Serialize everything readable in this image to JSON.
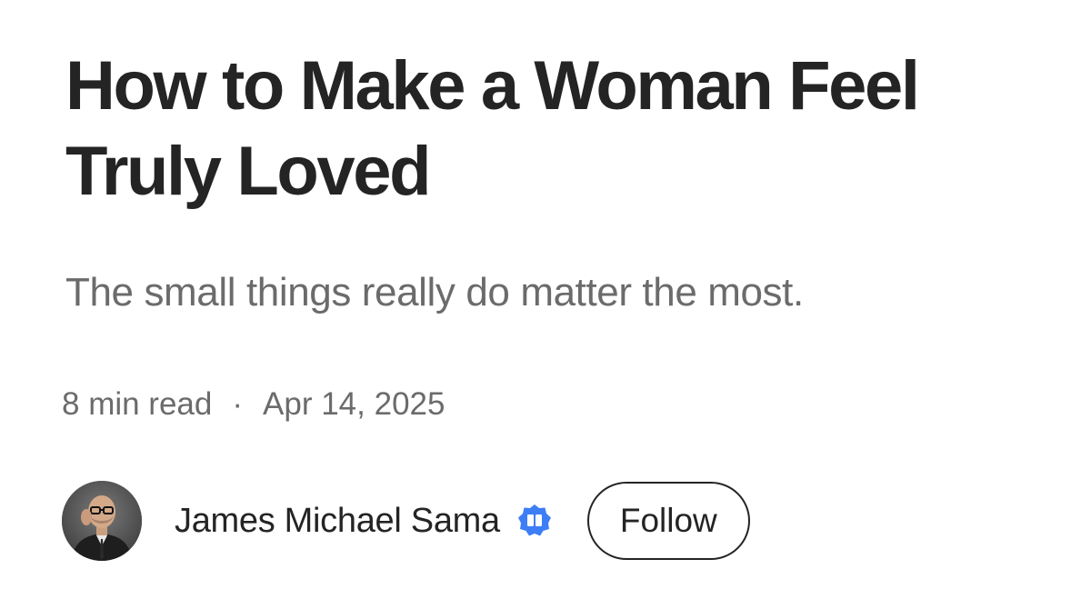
{
  "article": {
    "title": "How to Make a Woman Feel Truly Loved",
    "subtitle": "The small things really do matter the most.",
    "read_time": "8 min read",
    "separator": "·",
    "date": "Apr 14, 2025"
  },
  "author": {
    "name": "James Michael Sama",
    "verified_badge_icon": "verified-badge-icon",
    "follow_label": "Follow"
  },
  "colors": {
    "title": "#242424",
    "secondary_text": "#6b6b6b",
    "badge": "#3d7ef7"
  }
}
